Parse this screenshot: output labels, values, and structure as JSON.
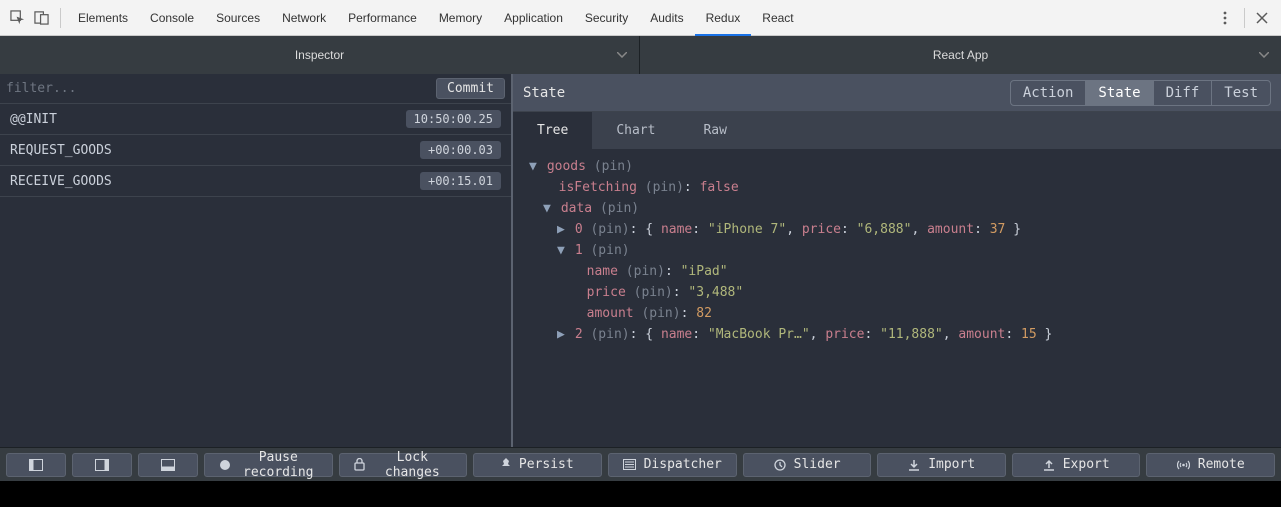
{
  "devtools_tabs": {
    "elements": "Elements",
    "console": "Console",
    "sources": "Sources",
    "network": "Network",
    "performance": "Performance",
    "memory": "Memory",
    "application": "Application",
    "security": "Security",
    "audits": "Audits",
    "redux": "Redux",
    "react": "React",
    "active": "redux"
  },
  "sub_header": {
    "inspector": "Inspector",
    "react_app": "React App"
  },
  "left": {
    "filter_placeholder": "filter...",
    "commit_label": "Commit",
    "actions": [
      {
        "name": "@@INIT",
        "ts": "10:50:00.25"
      },
      {
        "name": "REQUEST_GOODS",
        "ts": "+00:00.03"
      },
      {
        "name": "RECEIVE_GOODS",
        "ts": "+00:15.01"
      }
    ]
  },
  "right": {
    "header_title": "State",
    "mode_tabs": {
      "action": "Action",
      "state": "State",
      "diff": "Diff",
      "test": "Test",
      "active": "state"
    },
    "view_tabs": {
      "tree": "Tree",
      "chart": "Chart",
      "raw": "Raw",
      "active": "tree"
    },
    "pin_label": "(pin)",
    "tree": {
      "root_key": "goods",
      "isFetching_key": "isFetching",
      "isFetching_val": "false",
      "data_key": "data",
      "items": [
        {
          "idx": "0",
          "name": "iPhone 7",
          "price": "6,888",
          "amount": "37",
          "expanded": false
        },
        {
          "idx": "1",
          "name": "iPad",
          "price": "3,488",
          "amount": "82",
          "expanded": true
        },
        {
          "idx": "2",
          "name": "MacBook Pr…",
          "price": "11,888",
          "amount": "15",
          "expanded": false
        }
      ],
      "field_labels": {
        "name": "name",
        "price": "price",
        "amount": "amount"
      }
    }
  },
  "bottom": {
    "pause": "Pause recording",
    "lock": "Lock changes",
    "persist": "Persist",
    "dispatcher": "Dispatcher",
    "slider": "Slider",
    "import": "Import",
    "export": "Export",
    "remote": "Remote"
  }
}
